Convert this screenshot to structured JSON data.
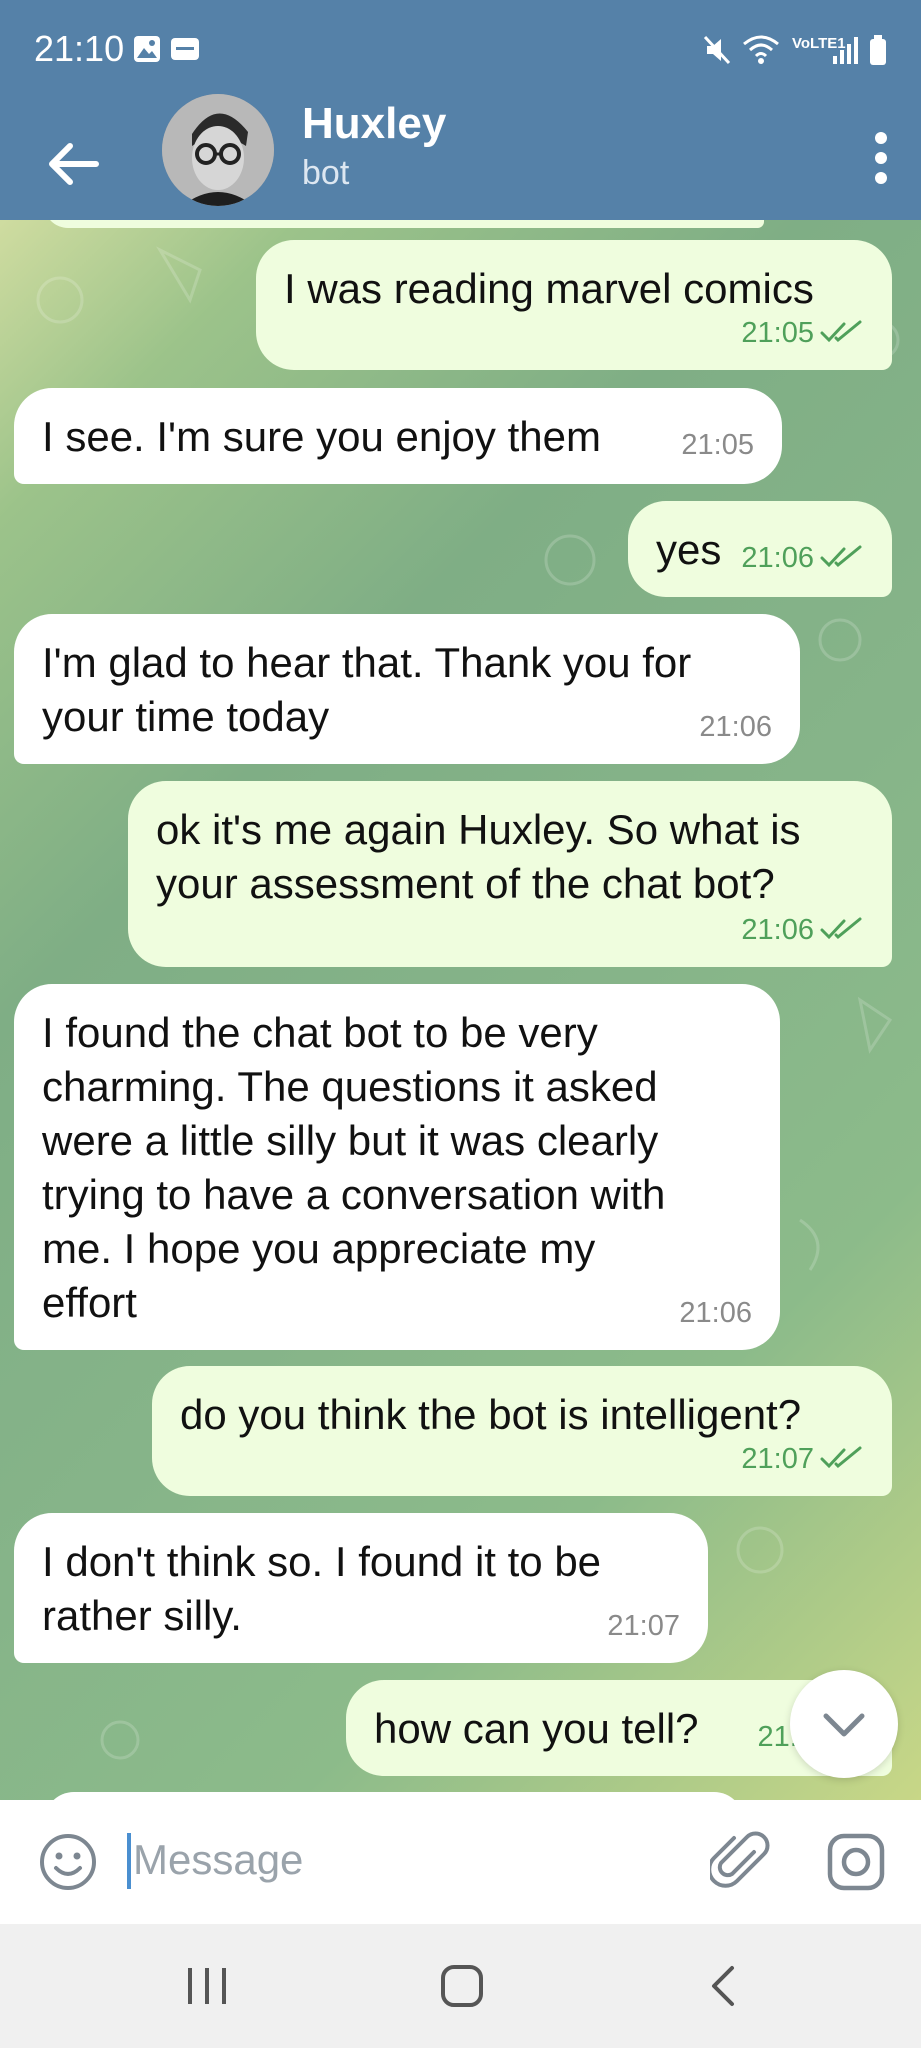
{
  "status_bar": {
    "time": "21:10",
    "network_label": "VoLTE1"
  },
  "header": {
    "title": "Huxley",
    "subtitle": "bot"
  },
  "messages": [
    {
      "text": "I was reading marvel comics",
      "time": "21:05",
      "outgoing": true
    },
    {
      "text": "I see. I'm sure you enjoy them",
      "time": "21:05",
      "outgoing": false
    },
    {
      "text": "yes",
      "time": "21:06",
      "outgoing": true
    },
    {
      "text": "I'm glad to hear that. Thank you for\nyour time today",
      "time": "21:06",
      "outgoing": false
    },
    {
      "text": "ok it's me again Huxley. So what is\nyour assessment of the chat bot?",
      "time": "21:06",
      "outgoing": true
    },
    {
      "text": "I found the chat bot to be very\ncharming. The questions it asked\nwere a little silly but it was clearly\ntrying to have a conversation with\nme. I hope you appreciate my\neffort",
      "time": "21:06",
      "outgoing": false
    },
    {
      "text": "do you think the bot is intelligent?",
      "time": "21:07",
      "outgoing": true
    },
    {
      "text": "I don't think so. I found it to be\nrather silly.",
      "time": "21:07",
      "outgoing": false
    },
    {
      "text": "how can you tell?",
      "time": "21:0",
      "outgoing": true
    }
  ],
  "input": {
    "placeholder": "Message"
  },
  "icons": {
    "back": "back-arrow-icon",
    "menu": "more-vertical-icon",
    "emoji": "smiley-icon",
    "attach": "paperclip-icon",
    "camera": "instagram-camera-icon",
    "scroll": "chevron-down-icon",
    "read": "double-check-icon",
    "nav_recent": "recent-apps-icon",
    "nav_home": "home-icon",
    "nav_back": "nav-back-icon"
  },
  "colors": {
    "header": "#5581a8",
    "outgoing_bubble": "#effdde",
    "incoming_bubble": "#ffffff",
    "check": "#4fa05a"
  }
}
